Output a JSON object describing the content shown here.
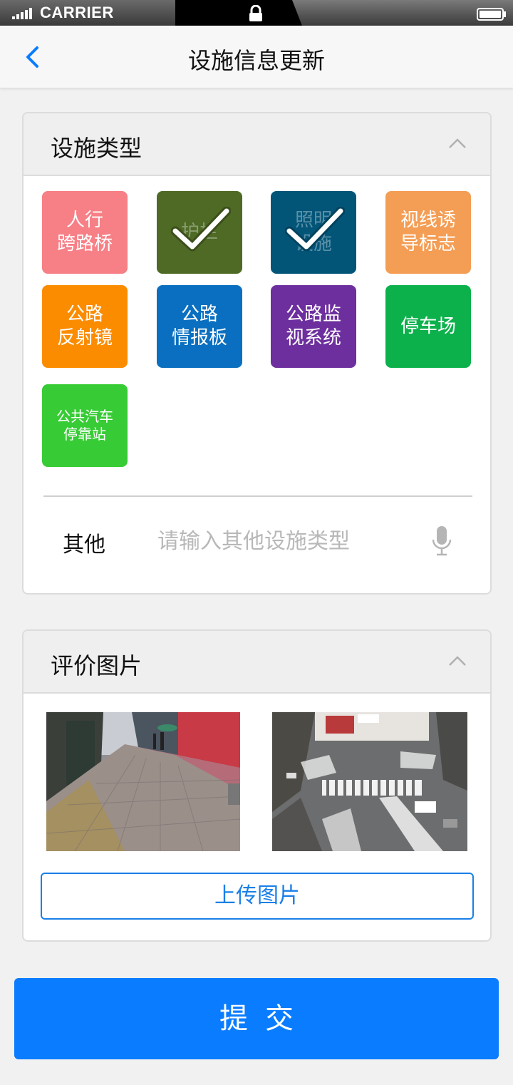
{
  "status_bar": {
    "carrier": "CARRIER"
  },
  "header": {
    "title": "设施信息更新"
  },
  "facility_section": {
    "title": "设施类型",
    "tiles": [
      {
        "label": "人行\n跨路桥",
        "color": "#f77f86",
        "selected": false
      },
      {
        "label": "护栏",
        "color": "#4e6a25",
        "selected": true
      },
      {
        "label": "照明\n设施",
        "color": "#035578",
        "selected": true
      },
      {
        "label": "视线诱\n导标志",
        "color": "#f49d54",
        "selected": false
      },
      {
        "label": "公路\n反射镜",
        "color": "#fb8c00",
        "selected": false
      },
      {
        "label": "公路\n情报板",
        "color": "#0a6fc0",
        "selected": false
      },
      {
        "label": "公路监\n视系统",
        "color": "#6d2f9e",
        "selected": false
      },
      {
        "label": "停车场",
        "color": "#0db14c",
        "selected": false
      },
      {
        "label": "公共汽车\n停靠站",
        "color": "#37cc35",
        "selected": false
      }
    ],
    "other_label": "其他",
    "other_placeholder": "请输入其他设施类型",
    "mic_icon": "microphone-icon"
  },
  "photos_section": {
    "title": "评价图片",
    "photos": [
      "sidewalk-photo",
      "crosswalk-intersection-photo"
    ],
    "upload_label": "上传图片"
  },
  "submit_label": "提交"
}
